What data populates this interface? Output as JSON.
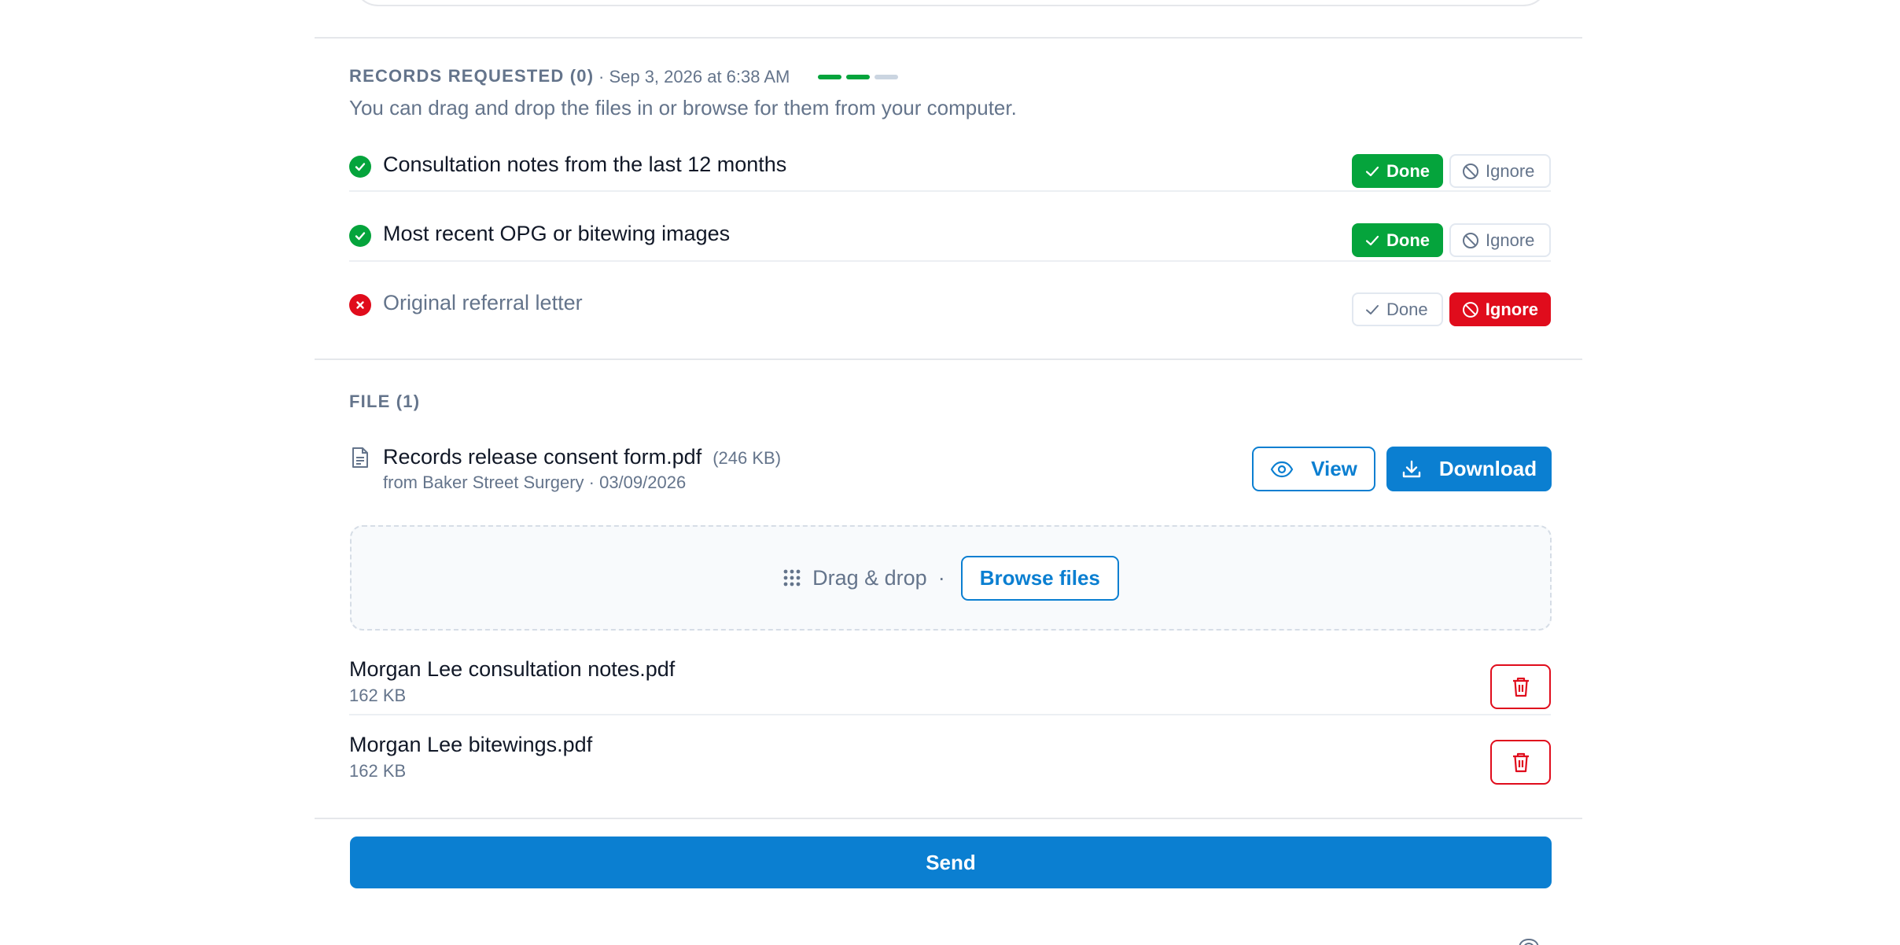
{
  "records": {
    "heading": "RECORDS REQUESTED (0)",
    "timestamp": "· Sep 3, 2026 at 6:38 AM",
    "progress": {
      "segments": [
        "done",
        "done",
        "pending"
      ],
      "colors": {
        "done": "#05a43c",
        "pending": "#cbd5e1"
      }
    },
    "description": "You can drag and drop the files in or browse for them from your computer.",
    "items": [
      {
        "label": "Consultation notes from the last 12 months",
        "status": "done",
        "done_label": "Done",
        "ignore_label": "Ignore"
      },
      {
        "label": "Most recent OPG or bitewing images",
        "status": "done",
        "done_label": "Done",
        "ignore_label": "Ignore"
      },
      {
        "label": "Original referral letter",
        "status": "ignored",
        "done_label": "Done",
        "ignore_label": "Ignore"
      }
    ]
  },
  "file_section": {
    "heading": "FILE (1)",
    "file": {
      "name": "Records release consent form.pdf",
      "size": "(246 KB)",
      "meta": "from Baker Street Surgery · 03/09/2026"
    },
    "view_label": "View",
    "download_label": "Download"
  },
  "dropzone": {
    "drag_text": "Drag & drop",
    "separator": "·",
    "browse_label": "Browse files"
  },
  "uploads": [
    {
      "name": "Morgan Lee consultation notes.pdf",
      "size": "162 KB"
    },
    {
      "name": "Morgan Lee bitewings.pdf",
      "size": "162 KB"
    }
  ],
  "send_label": "Send",
  "colors": {
    "accent": "#0b7fd1",
    "success": "#05a43c",
    "danger": "#e00c1c",
    "muted": "#64748b"
  }
}
